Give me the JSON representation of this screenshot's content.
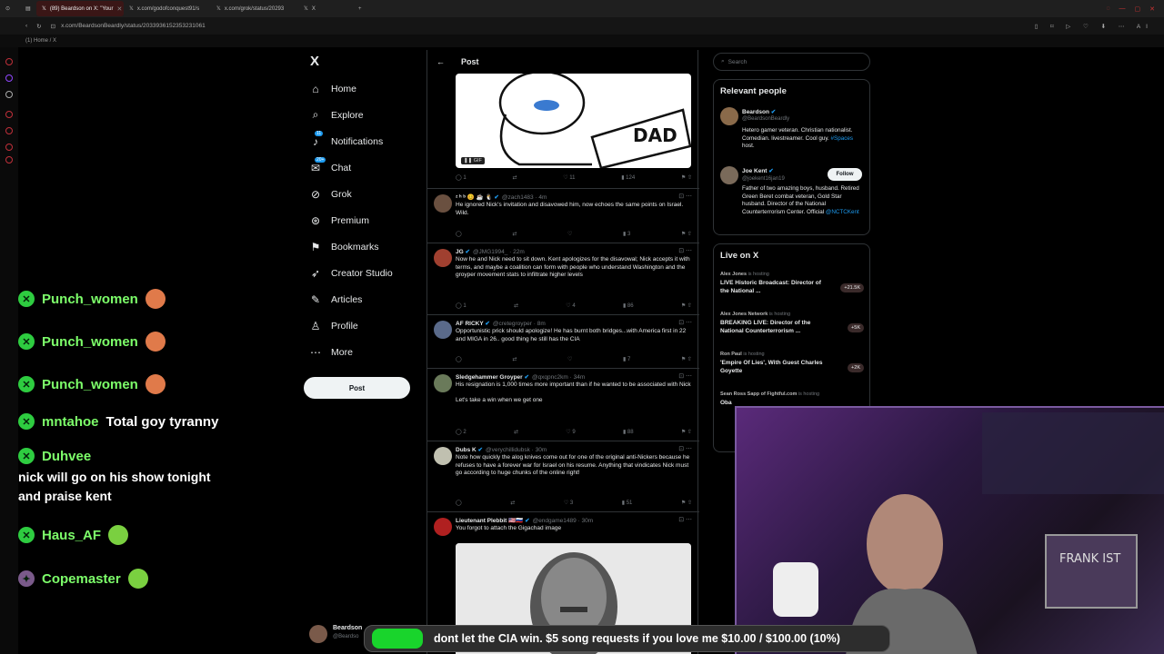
{
  "browser": {
    "tabs": [
      {
        "label": "(89) Beardson on X: \"Your",
        "active": true
      },
      {
        "label": "x.com/godofconquest91/s",
        "active": false
      },
      {
        "label": "x.com/grok/status/20293",
        "active": false
      },
      {
        "label": "X",
        "active": false
      }
    ],
    "url": "x.com/BeardsonBeardly/status/2033936152353231061",
    "bookmark": "(1) Home / X"
  },
  "nav": {
    "logo": "X",
    "items": [
      {
        "label": "Home",
        "icon": "home-icon",
        "glyph": "⌂"
      },
      {
        "label": "Explore",
        "icon": "explore-icon",
        "glyph": "⌕"
      },
      {
        "label": "Notifications",
        "icon": "bell-icon",
        "glyph": "♪",
        "badge": "11"
      },
      {
        "label": "Chat",
        "icon": "chat-icon",
        "glyph": "✉",
        "badge": "20+"
      },
      {
        "label": "Grok",
        "icon": "grok-icon",
        "glyph": "⊘"
      },
      {
        "label": "Premium",
        "icon": "premium-icon",
        "glyph": "⊛"
      },
      {
        "label": "Bookmarks",
        "icon": "bookmark-icon",
        "glyph": "⚑"
      },
      {
        "label": "Creator Studio",
        "icon": "rocket-icon",
        "glyph": "➶"
      },
      {
        "label": "Articles",
        "icon": "articles-icon",
        "glyph": "✎"
      },
      {
        "label": "Profile",
        "icon": "profile-icon",
        "glyph": "♙"
      },
      {
        "label": "More",
        "icon": "more-icon",
        "glyph": "⋯"
      }
    ],
    "post_button": "Post"
  },
  "timeline": {
    "header": "Post",
    "top_media_actions": {
      "replies": "1",
      "retweets": "",
      "likes": "11",
      "views": "124"
    },
    "gif_label": "GIF",
    "replies": [
      {
        "name": "ᶻ ʰ ᵇ 😊 ☕ 🐧",
        "handle": "@zach1483 · 4m",
        "text": "He ignored Nick's invitation and disavowed him, now echoes the same points on Israel. Wild.",
        "replies": "",
        "retweets": "",
        "likes": "",
        "views": "3"
      },
      {
        "name": "JG",
        "handle": "@JMG1994_ · 22m",
        "text": "Now he and Nick need to sit down. Kent apologizes for the disavowal; Nick accepts it with terms, and maybe a coalition can form with people who understand Washington and the groyper movement stats to infiltrate higher levels",
        "replies": "1",
        "retweets": "",
        "likes": "4",
        "views": "86"
      },
      {
        "name": "AF RICKY",
        "handle": "@cretegroyper · 8m",
        "text": "Opportunistic prick should apologize! He has burnt both bridges...with America first in 22 and MIGA in 26.. good thing he still has the CIA",
        "replies": "",
        "retweets": "",
        "likes": "",
        "views": "7"
      },
      {
        "name": "Sledgehammer Groyper",
        "handle": "@qxqpnc2km · 34m",
        "text": "His resignation is 1,000 times more important than if he wanted to be associated with Nick\n\nLet's take a win when we get one",
        "replies": "2",
        "retweets": "",
        "likes": "9",
        "views": "88"
      },
      {
        "name": "Dubs K",
        "handle": "@verychillidubsk · 30m",
        "text": "Note how quickly the alog knives come out for one of the original anti-Nickers because he refuses to have a forever war for Israel on his resume. Anything that vindicates Nick must go according to huge chunks of the online right!",
        "replies": "",
        "retweets": "",
        "likes": "3",
        "views": "51"
      },
      {
        "name": "Lieutenant Plebbit 🇺🇸🇷🇺",
        "handle": "@endgame1489 · 30m",
        "text": "You forgot to attach the Gigachad image"
      }
    ]
  },
  "right": {
    "search_placeholder": "Search",
    "relevant_title": "Relevant people",
    "people": [
      {
        "name": "Beardson",
        "handle": "@BeardsonBeardly",
        "bio": "Hetero gamer veteran. Christian nationalist. Comedian. livestreamer. Cool guy.",
        "bio_link": "#Spaces",
        "bio_end": "host."
      },
      {
        "name": "Joe Kent",
        "handle": "@joekent16jan19",
        "bio": "Father of two amazing boys, husband. Retired Green Beret combat veteran, Gold Star husband. Director of the National Counterterrorism Center. Official",
        "bio_link": "@NCTCKent",
        "follow": "Follow"
      }
    ],
    "live_title": "Live on X",
    "live": [
      {
        "host": "Alex Jones",
        "status": "is hosting",
        "title": "LIVE Historic Broadcast: Director of the National ...",
        "count": "+21.5K"
      },
      {
        "host": "Alex Jones Network",
        "status": "is hosting",
        "title": "BREAKING LIVE: Director of the National Counterterrorism ...",
        "count": "+5K"
      },
      {
        "host": "Ron Paul",
        "status": "is hosting",
        "title": "'Empire Of Lies', With Guest Charles Goyette",
        "count": "+2K"
      },
      {
        "host": "Sean Ross Sapp of Fightful.com",
        "status": "is hosting",
        "title": "Oba",
        "count": ""
      }
    ]
  },
  "chat": {
    "messages": [
      {
        "user": "Punch_women",
        "text": ""
      },
      {
        "user": "Punch_women",
        "text": ""
      },
      {
        "user": "Punch_women",
        "text": ""
      },
      {
        "user": "mntahoe",
        "text": "Total goy tyranny"
      },
      {
        "user": "Duhvee",
        "text": "nick will go on his show tonight and praise kent"
      },
      {
        "user": "Haus_AF",
        "text": ""
      },
      {
        "user": "Copemaster",
        "text": ""
      }
    ]
  },
  "bottom": {
    "profile_name": "Beardson",
    "profile_handle": "@Beardso"
  },
  "banner": {
    "text": "dont let the CIA win. $5 song requests if you love me $10.00 / $100.00 (10%)",
    "progress": 0.1
  },
  "colors": {
    "accent": "#1d9bf0",
    "chat_green": "#2ecc40",
    "banner_green": "#19d42c"
  }
}
